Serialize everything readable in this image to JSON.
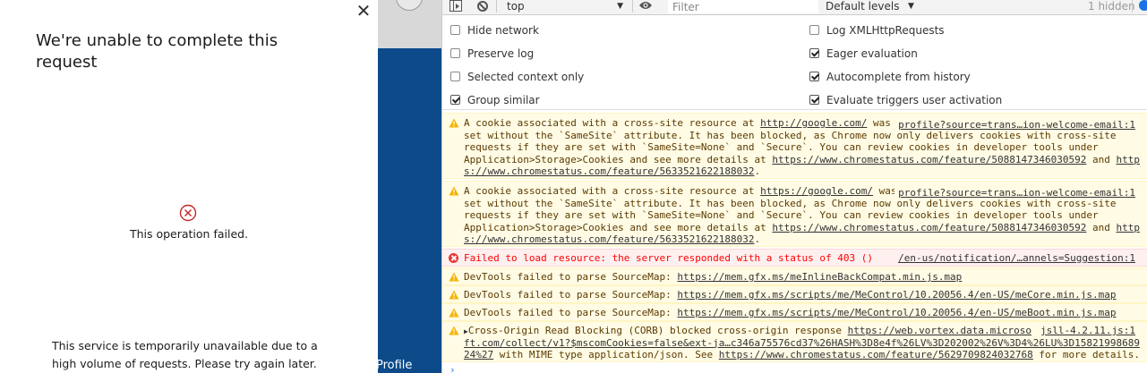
{
  "dialog": {
    "close_glyph": "✕",
    "title": "We're unable to complete this request",
    "failed_text": "This operation failed.",
    "message": "This service is temporarily unavailable due to a high volume of requests. Please try again later."
  },
  "page_behind": {
    "profile_text": "Profile"
  },
  "devtools": {
    "toolbar": {
      "context_value": "top",
      "filter_placeholder": "Filter",
      "levels_value": "Default levels",
      "hidden_count": "1 hidden"
    },
    "settings": {
      "left": [
        {
          "label": "Hide network",
          "checked": false
        },
        {
          "label": "Preserve log",
          "checked": false
        },
        {
          "label": "Selected context only",
          "checked": false
        },
        {
          "label": "Group similar",
          "checked": true
        }
      ],
      "right": [
        {
          "label": "Log XMLHttpRequests",
          "checked": false
        },
        {
          "label": "Eager evaluation",
          "checked": true
        },
        {
          "label": "Autocomplete from history",
          "checked": true
        },
        {
          "label": "Evaluate triggers user activation",
          "checked": true
        }
      ]
    },
    "messages": {
      "m1": {
        "l1a": "A cookie associated with a cross-site resource at ",
        "l1link": "http://google.com/",
        "l1b": " was",
        "l2": "set without the `SameSite` attribute. It has been blocked, as Chrome now only delivers cookies with cross-site",
        "l3": "requests if they are set with `SameSite=None` and `Secure`. You can review cookies in developer tools under",
        "l4a": "Application>Storage>Cookies and see more details at ",
        "l4link": "https://www.chromestatus.com/feature/5088147346030592",
        "l4b": " and ",
        "l4link2": "http",
        "l5link": "s://www.chromestatus.com/feature/5633521622188032",
        "l5b": ".",
        "source": "profile?source=trans…ion-welcome-email:1"
      },
      "m2": {
        "l1a": "A cookie associated with a cross-site resource at ",
        "l1link": "https://google.com/",
        "l1b": " was",
        "l2": "set without the `SameSite` attribute. It has been blocked, as Chrome now only delivers cookies with cross-site",
        "l3": "requests if they are set with `SameSite=None` and `Secure`. You can review cookies in developer tools under",
        "l4a": "Application>Storage>Cookies and see more details at ",
        "l4link": "https://www.chromestatus.com/feature/5088147346030592",
        "l4b": " and ",
        "l4link2": "http",
        "l5link": "s://www.chromestatus.com/feature/5633521622188032",
        "l5b": ".",
        "source": "profile?source=trans…ion-welcome-email:1"
      },
      "m3": {
        "text": "Failed to load resource: the server responded with a status of 403 ()",
        "source": "/en-us/notification/…annels=Suggestion:1"
      },
      "m4": {
        "text": "DevTools failed to parse SourceMap: ",
        "link": "https://mem.gfx.ms/meInlineBackCompat.min.js.map"
      },
      "m5": {
        "text": "DevTools failed to parse SourceMap: ",
        "link": "https://mem.gfx.ms/scripts/me/MeControl/10.20056.4/en-US/meCore.min.js.map"
      },
      "m6": {
        "text": "DevTools failed to parse SourceMap: ",
        "link": "https://mem.gfx.ms/scripts/me/MeControl/10.20056.4/en-US/meBoot.min.js.map"
      },
      "m7": {
        "triangle": "▶",
        "l1a": "Cross-Origin Read Blocking (CORB) blocked cross-origin response ",
        "l1link": "https://web.vortex.data.microso",
        "l2link": "ft.com/collect/v1?$mscomCookies=false&ext-ja…c346a75576cd37%26HASH%3D8e4f%26LV%3D202002%26V%3D4%26LU%3D15821998689",
        "l3link": "24%27",
        "l3a": " with MIME type application/json. See ",
        "l3link2": "https://www.chromestatus.com/feature/5629709824032768",
        "l3b": " for more details.",
        "source": "jsll-4.2.11.js:1"
      }
    },
    "prompt": "›"
  }
}
